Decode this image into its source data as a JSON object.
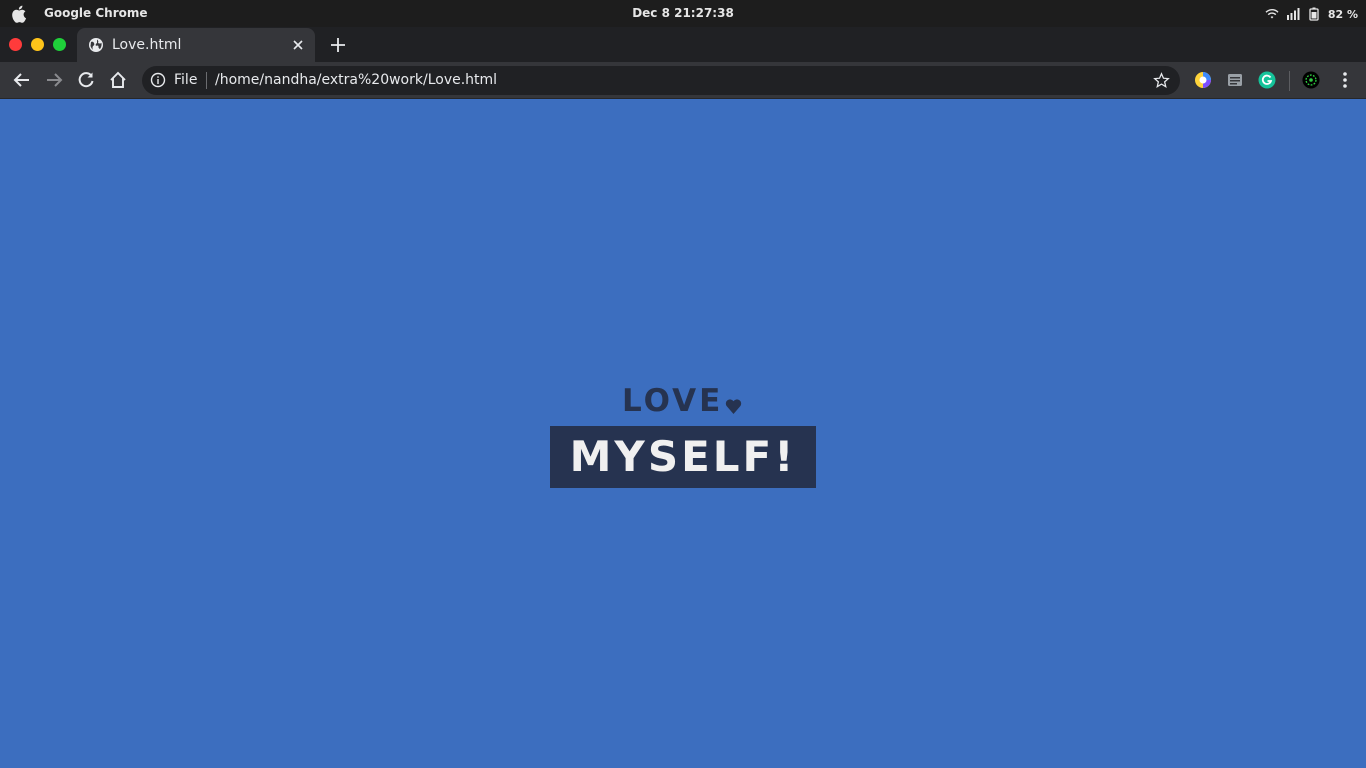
{
  "os_bar": {
    "app_name": "Google Chrome",
    "datetime": "Dec 8  21:27:38",
    "battery": "82 %"
  },
  "browser": {
    "tab": {
      "title": "Love.html"
    },
    "address": {
      "scheme_label": "File",
      "url": "/home/nandha/extra%20work/Love.html"
    },
    "extensions": [
      "colorful-circle-extension-icon",
      "reader-extension-icon",
      "grammarly-icon",
      "profile-avatar-icon"
    ]
  },
  "page": {
    "line1": "LOVE",
    "line2": "MYSELF!"
  },
  "colors": {
    "page_bg": "#3c6ebf",
    "accent_dark": "#263350",
    "text_light": "#f0f0f0"
  }
}
